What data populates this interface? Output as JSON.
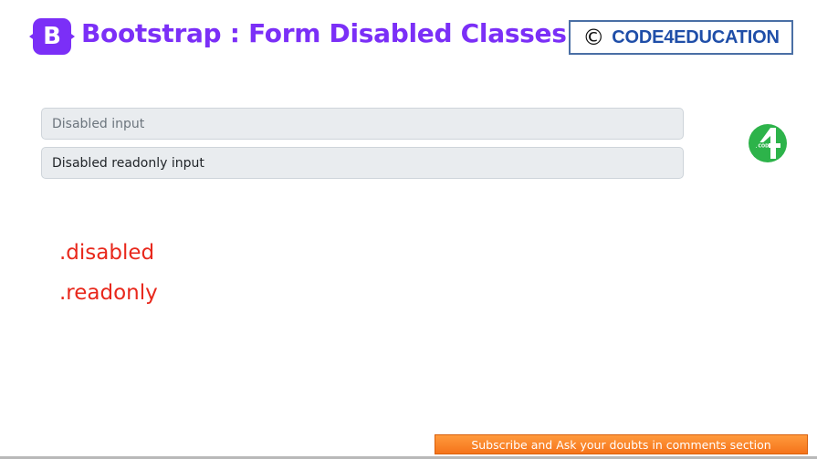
{
  "header": {
    "logo_letter": "B",
    "title": "Bootstrap : Form Disabled Classes",
    "copyright_symbol": "©",
    "brand": "CODE4EDUCATION"
  },
  "form": {
    "disabled_input": {
      "placeholder": "Disabled input",
      "value": ""
    },
    "readonly_input": {
      "placeholder": "",
      "value": "Disabled readonly input"
    }
  },
  "side_logo": {
    "numeral": "4",
    "caption": "CODE"
  },
  "class_names": {
    "disabled": ".disabled",
    "readonly": ".readonly"
  },
  "footer": {
    "subscribe_text": "Subscribe and Ask your doubts in comments section"
  },
  "colors": {
    "bootstrap_purple": "#7b2ff7",
    "brand_blue": "#1f4ea8",
    "class_red": "#e8281c",
    "banner_orange": "#f5731a",
    "logo_green": "#2db34a"
  }
}
